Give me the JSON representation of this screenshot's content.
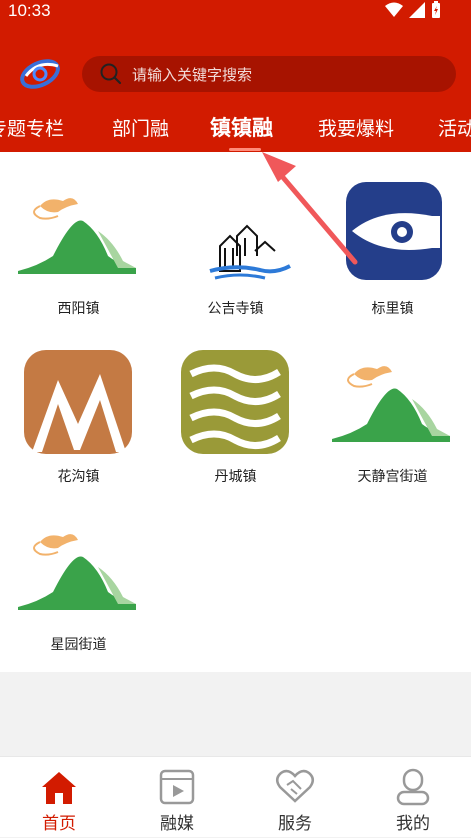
{
  "status_bar": {
    "time": "10:33"
  },
  "header": {
    "search_placeholder": "请输入关键字搜索",
    "tabs": [
      {
        "label": "专题专栏"
      },
      {
        "label": "部门融"
      },
      {
        "label": "镇镇融",
        "active": true
      },
      {
        "label": "我要爆料"
      },
      {
        "label": "活动"
      }
    ]
  },
  "towns": [
    {
      "name": "西阳镇",
      "icon": "mountain-logo"
    },
    {
      "name": "公吉寺镇",
      "icon": "village-logo"
    },
    {
      "name": "标里镇",
      "icon": "fish-logo"
    },
    {
      "name": "花沟镇",
      "icon": "m-logo"
    },
    {
      "name": "丹城镇",
      "icon": "waves-logo"
    },
    {
      "name": "天静宫街道",
      "icon": "mountain-logo"
    },
    {
      "name": "星园街道",
      "icon": "mountain-logo"
    }
  ],
  "bottom_nav": [
    {
      "label": "首页",
      "icon": "home-icon",
      "active": true
    },
    {
      "label": "融媒",
      "icon": "video-icon"
    },
    {
      "label": "服务",
      "icon": "handshake-icon"
    },
    {
      "label": "我的",
      "icon": "user-icon"
    }
  ],
  "colors": {
    "brand_red": "#d21b00",
    "search_bg": "#a71300"
  }
}
